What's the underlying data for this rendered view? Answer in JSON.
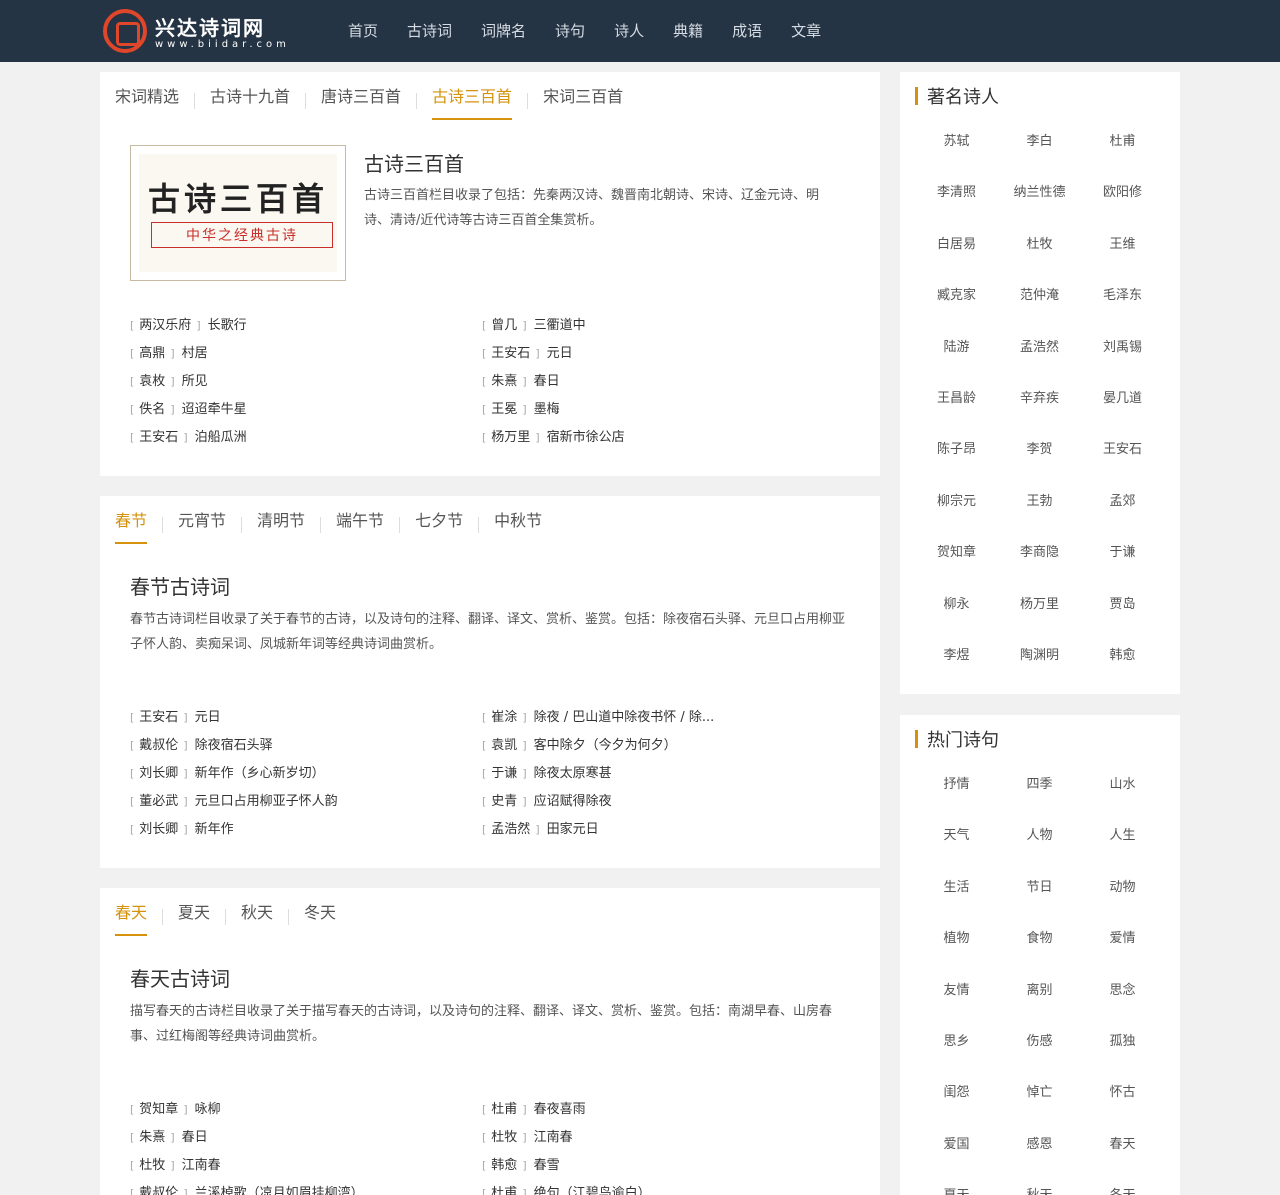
{
  "site": {
    "name": "兴达诗词网",
    "url_text": "www.biidar.com"
  },
  "nav": [
    "首页",
    "古诗词",
    "词牌名",
    "诗句",
    "诗人",
    "典籍",
    "成语",
    "文章"
  ],
  "section1": {
    "tabs": [
      "宋词精选",
      "古诗十九首",
      "唐诗三百首",
      "古诗三百首",
      "宋词三百首"
    ],
    "active_tab": 3,
    "cover_big": "古诗三百首",
    "cover_small": "中华之经典古诗",
    "title": "古诗三百首",
    "desc": "古诗三百首栏目收录了包括：先秦两汉诗、魏晋南北朝诗、宋诗、辽金元诗、明诗、清诗/近代诗等古诗三百首全集赏析。",
    "poems": [
      {
        "author": "两汉乐府",
        "title": "长歌行"
      },
      {
        "author": "曾几",
        "title": "三衢道中"
      },
      {
        "author": "高鼎",
        "title": "村居"
      },
      {
        "author": "王安石",
        "title": "元日"
      },
      {
        "author": "袁枚",
        "title": "所见"
      },
      {
        "author": "朱熹",
        "title": "春日"
      },
      {
        "author": "佚名",
        "title": "迢迢牵牛星"
      },
      {
        "author": "王冕",
        "title": "墨梅"
      },
      {
        "author": "王安石",
        "title": "泊船瓜洲"
      },
      {
        "author": "杨万里",
        "title": "宿新市徐公店"
      }
    ]
  },
  "section2": {
    "tabs": [
      "春节",
      "元宵节",
      "清明节",
      "端午节",
      "七夕节",
      "中秋节"
    ],
    "active_tab": 0,
    "title": "春节古诗词",
    "desc": "春节古诗词栏目收录了关于春节的古诗，以及诗句的注释、翻译、译文、赏析、鉴赏。包括：除夜宿石头驿、元旦口占用柳亚子怀人韵、卖痴呆词、凤城新年词等经典诗词曲赏析。",
    "poems": [
      {
        "author": "王安石",
        "title": "元日"
      },
      {
        "author": "崔涂",
        "title": "除夜 / 巴山道中除夜书怀 / 除..."
      },
      {
        "author": "戴叔伦",
        "title": "除夜宿石头驿"
      },
      {
        "author": "袁凯",
        "title": "客中除夕（今夕为何夕）"
      },
      {
        "author": "刘长卿",
        "title": "新年作（乡心新岁切）"
      },
      {
        "author": "于谦",
        "title": "除夜太原寒甚"
      },
      {
        "author": "董必武",
        "title": "元旦口占用柳亚子怀人韵"
      },
      {
        "author": "史青",
        "title": "应诏赋得除夜"
      },
      {
        "author": "刘长卿",
        "title": "新年作"
      },
      {
        "author": "孟浩然",
        "title": "田家元日"
      }
    ]
  },
  "section3": {
    "tabs": [
      "春天",
      "夏天",
      "秋天",
      "冬天"
    ],
    "active_tab": 0,
    "title": "春天古诗词",
    "desc": "描写春天的古诗栏目收录了关于描写春天的古诗词，以及诗句的注释、翻译、译文、赏析、鉴赏。包括：南湖早春、山房春事、过红梅阁等经典诗词曲赏析。",
    "poems": [
      {
        "author": "贺知章",
        "title": "咏柳"
      },
      {
        "author": "杜甫",
        "title": "春夜喜雨"
      },
      {
        "author": "朱熹",
        "title": "春日"
      },
      {
        "author": "杜牧",
        "title": "江南春"
      },
      {
        "author": "杜牧",
        "title": "江南春"
      },
      {
        "author": "韩愈",
        "title": "春雪"
      },
      {
        "author": "戴叔伦",
        "title": "兰溪棹歌（凉月如眉挂柳湾）"
      },
      {
        "author": "杜甫",
        "title": "绝句（江碧鸟逾白）"
      }
    ]
  },
  "poets": {
    "title": "著名诗人",
    "items": [
      "苏轼",
      "李白",
      "杜甫",
      "李清照",
      "纳兰性德",
      "欧阳修",
      "白居易",
      "杜牧",
      "王维",
      "臧克家",
      "范仲淹",
      "毛泽东",
      "陆游",
      "孟浩然",
      "刘禹锡",
      "王昌龄",
      "辛弃疾",
      "晏几道",
      "陈子昂",
      "李贺",
      "王安石",
      "柳宗元",
      "王勃",
      "孟郊",
      "贺知章",
      "李商隐",
      "于谦",
      "柳永",
      "杨万里",
      "贾岛",
      "李煜",
      "陶渊明",
      "韩愈"
    ]
  },
  "hot": {
    "title": "热门诗句",
    "items": [
      "抒情",
      "四季",
      "山水",
      "天气",
      "人物",
      "人生",
      "生活",
      "节日",
      "动物",
      "植物",
      "食物",
      "爱情",
      "友情",
      "离别",
      "思念",
      "思乡",
      "伤感",
      "孤独",
      "闺怨",
      "悼亡",
      "怀古",
      "爱国",
      "感恩",
      "春天",
      "夏天",
      "秋天",
      "冬天"
    ]
  },
  "colors": {
    "header_bg": "#253444",
    "accent": "#d5920d",
    "logo": "#e0462a"
  }
}
